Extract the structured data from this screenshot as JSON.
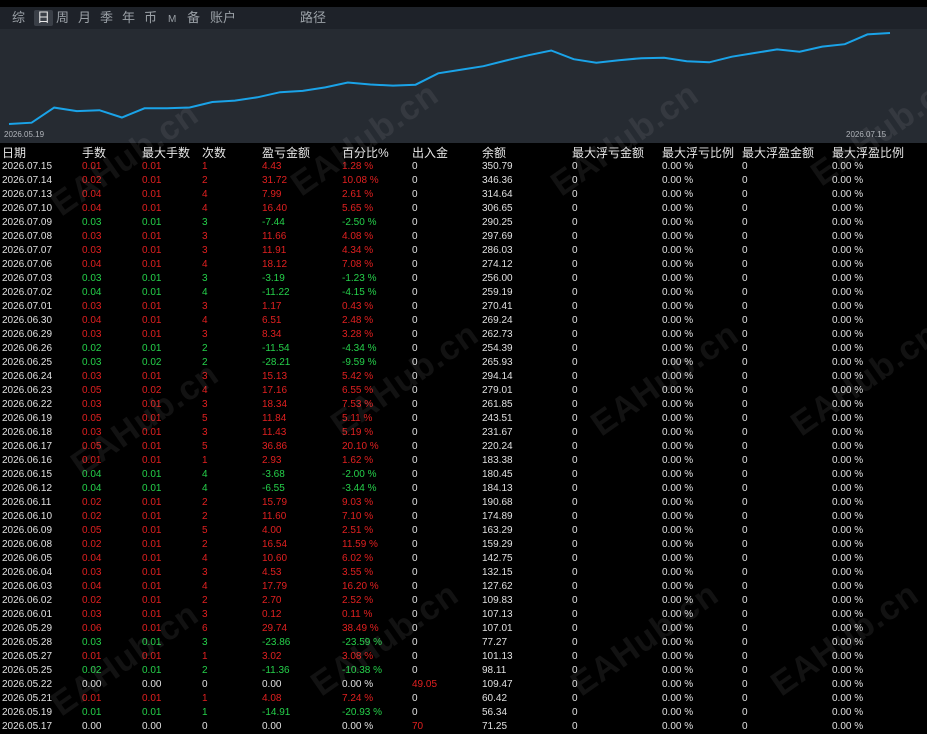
{
  "tabs": [
    "综",
    "日",
    "周",
    "月",
    "季",
    "年",
    "币",
    "M",
    "备",
    "账户",
    "路径"
  ],
  "active_tab": "日",
  "chart": {
    "start_label": "2026.05.19",
    "end_label": "2026.07.15",
    "line_color": "#1aa3e8",
    "equity": [
      56.34,
      60.42,
      109.47,
      98.11,
      101.13,
      77.27,
      107.01,
      107.13,
      109.83,
      127.62,
      132.15,
      142.75,
      159.29,
      163.29,
      174.89,
      190.68,
      184.13,
      180.45,
      183.38,
      220.24,
      231.67,
      243.51,
      261.85,
      279.01,
      294.14,
      265.93,
      254.39,
      262.73,
      269.24,
      270.41,
      259.19,
      256.0,
      274.12,
      286.03,
      297.69,
      290.25,
      306.65,
      314.64,
      346.36,
      350.79
    ]
  },
  "watermark": "EAHub.cn",
  "columns": [
    "日期",
    "手数",
    "最大手数",
    "次数",
    "盈亏金额",
    "百分比%",
    "出入金",
    "余额",
    "最大浮亏金额",
    "最大浮亏比例",
    "最大浮盈金额",
    "最大浮盈比例"
  ],
  "rows": [
    [
      "2026.07.15",
      "0.01",
      "0.01",
      "1",
      "4.43",
      "1.28 %",
      "0",
      "350.79",
      "0",
      "0.00 %",
      "0",
      "0.00 %"
    ],
    [
      "2026.07.14",
      "0.02",
      "0.01",
      "2",
      "31.72",
      "10.08 %",
      "0",
      "346.36",
      "0",
      "0.00 %",
      "0",
      "0.00 %"
    ],
    [
      "2026.07.13",
      "0.04",
      "0.01",
      "4",
      "7.99",
      "2.61 %",
      "0",
      "314.64",
      "0",
      "0.00 %",
      "0",
      "0.00 %"
    ],
    [
      "2026.07.10",
      "0.04",
      "0.01",
      "4",
      "16.40",
      "5.65 %",
      "0",
      "306.65",
      "0",
      "0.00 %",
      "0",
      "0.00 %"
    ],
    [
      "2026.07.09",
      "0.03",
      "0.01",
      "3",
      "-7.44",
      "-2.50 %",
      "0",
      "290.25",
      "0",
      "0.00 %",
      "0",
      "0.00 %"
    ],
    [
      "2026.07.08",
      "0.03",
      "0.01",
      "3",
      "11.66",
      "4.08 %",
      "0",
      "297.69",
      "0",
      "0.00 %",
      "0",
      "0.00 %"
    ],
    [
      "2026.07.07",
      "0.03",
      "0.01",
      "3",
      "11.91",
      "4.34 %",
      "0",
      "286.03",
      "0",
      "0.00 %",
      "0",
      "0.00 %"
    ],
    [
      "2026.07.06",
      "0.04",
      "0.01",
      "4",
      "18.12",
      "7.08 %",
      "0",
      "274.12",
      "0",
      "0.00 %",
      "0",
      "0.00 %"
    ],
    [
      "2026.07.03",
      "0.03",
      "0.01",
      "3",
      "-3.19",
      "-1.23 %",
      "0",
      "256.00",
      "0",
      "0.00 %",
      "0",
      "0.00 %"
    ],
    [
      "2026.07.02",
      "0.04",
      "0.01",
      "4",
      "-11.22",
      "-4.15 %",
      "0",
      "259.19",
      "0",
      "0.00 %",
      "0",
      "0.00 %"
    ],
    [
      "2026.07.01",
      "0.03",
      "0.01",
      "3",
      "1.17",
      "0.43 %",
      "0",
      "270.41",
      "0",
      "0.00 %",
      "0",
      "0.00 %"
    ],
    [
      "2026.06.30",
      "0.04",
      "0.01",
      "4",
      "6.51",
      "2.48 %",
      "0",
      "269.24",
      "0",
      "0.00 %",
      "0",
      "0.00 %"
    ],
    [
      "2026.06.29",
      "0.03",
      "0.01",
      "3",
      "8.34",
      "3.28 %",
      "0",
      "262.73",
      "0",
      "0.00 %",
      "0",
      "0.00 %"
    ],
    [
      "2026.06.26",
      "0.02",
      "0.01",
      "2",
      "-11.54",
      "-4.34 %",
      "0",
      "254.39",
      "0",
      "0.00 %",
      "0",
      "0.00 %"
    ],
    [
      "2026.06.25",
      "0.03",
      "0.02",
      "2",
      "-28.21",
      "-9.59 %",
      "0",
      "265.93",
      "0",
      "0.00 %",
      "0",
      "0.00 %"
    ],
    [
      "2026.06.24",
      "0.03",
      "0.01",
      "3",
      "15.13",
      "5.42 %",
      "0",
      "294.14",
      "0",
      "0.00 %",
      "0",
      "0.00 %"
    ],
    [
      "2026.06.23",
      "0.05",
      "0.02",
      "4",
      "17.16",
      "6.55 %",
      "0",
      "279.01",
      "0",
      "0.00 %",
      "0",
      "0.00 %"
    ],
    [
      "2026.06.22",
      "0.03",
      "0.01",
      "3",
      "18.34",
      "7.53 %",
      "0",
      "261.85",
      "0",
      "0.00 %",
      "0",
      "0.00 %"
    ],
    [
      "2026.06.19",
      "0.05",
      "0.01",
      "5",
      "11.84",
      "5.11 %",
      "0",
      "243.51",
      "0",
      "0.00 %",
      "0",
      "0.00 %"
    ],
    [
      "2026.06.18",
      "0.03",
      "0.01",
      "3",
      "11.43",
      "5.19 %",
      "0",
      "231.67",
      "0",
      "0.00 %",
      "0",
      "0.00 %"
    ],
    [
      "2026.06.17",
      "0.05",
      "0.01",
      "5",
      "36.86",
      "20.10 %",
      "0",
      "220.24",
      "0",
      "0.00 %",
      "0",
      "0.00 %"
    ],
    [
      "2026.06.16",
      "0.01",
      "0.01",
      "1",
      "2.93",
      "1.62 %",
      "0",
      "183.38",
      "0",
      "0.00 %",
      "0",
      "0.00 %"
    ],
    [
      "2026.06.15",
      "0.04",
      "0.01",
      "4",
      "-3.68",
      "-2.00 %",
      "0",
      "180.45",
      "0",
      "0.00 %",
      "0",
      "0.00 %"
    ],
    [
      "2026.06.12",
      "0.04",
      "0.01",
      "4",
      "-6.55",
      "-3.44 %",
      "0",
      "184.13",
      "0",
      "0.00 %",
      "0",
      "0.00 %"
    ],
    [
      "2026.06.11",
      "0.02",
      "0.01",
      "2",
      "15.79",
      "9.03 %",
      "0",
      "190.68",
      "0",
      "0.00 %",
      "0",
      "0.00 %"
    ],
    [
      "2026.06.10",
      "0.02",
      "0.01",
      "2",
      "11.60",
      "7.10 %",
      "0",
      "174.89",
      "0",
      "0.00 %",
      "0",
      "0.00 %"
    ],
    [
      "2026.06.09",
      "0.05",
      "0.01",
      "5",
      "4.00",
      "2.51 %",
      "0",
      "163.29",
      "0",
      "0.00 %",
      "0",
      "0.00 %"
    ],
    [
      "2026.06.08",
      "0.02",
      "0.01",
      "2",
      "16.54",
      "11.59 %",
      "0",
      "159.29",
      "0",
      "0.00 %",
      "0",
      "0.00 %"
    ],
    [
      "2026.06.05",
      "0.04",
      "0.01",
      "4",
      "10.60",
      "6.02 %",
      "0",
      "142.75",
      "0",
      "0.00 %",
      "0",
      "0.00 %"
    ],
    [
      "2026.06.04",
      "0.03",
      "0.01",
      "3",
      "4.53",
      "3.55 %",
      "0",
      "132.15",
      "0",
      "0.00 %",
      "0",
      "0.00 %"
    ],
    [
      "2026.06.03",
      "0.04",
      "0.01",
      "4",
      "17.79",
      "16.20 %",
      "0",
      "127.62",
      "0",
      "0.00 %",
      "0",
      "0.00 %"
    ],
    [
      "2026.06.02",
      "0.02",
      "0.01",
      "2",
      "2.70",
      "2.52 %",
      "0",
      "109.83",
      "0",
      "0.00 %",
      "0",
      "0.00 %"
    ],
    [
      "2026.06.01",
      "0.03",
      "0.01",
      "3",
      "0.12",
      "0.11 %",
      "0",
      "107.13",
      "0",
      "0.00 %",
      "0",
      "0.00 %"
    ],
    [
      "2026.05.29",
      "0.06",
      "0.01",
      "6",
      "29.74",
      "38.49 %",
      "0",
      "107.01",
      "0",
      "0.00 %",
      "0",
      "0.00 %"
    ],
    [
      "2026.05.28",
      "0.03",
      "0.01",
      "3",
      "-23.86",
      "-23.59 %",
      "0",
      "77.27",
      "0",
      "0.00 %",
      "0",
      "0.00 %"
    ],
    [
      "2026.05.27",
      "0.01",
      "0.01",
      "1",
      "3.02",
      "3.08 %",
      "0",
      "101.13",
      "0",
      "0.00 %",
      "0",
      "0.00 %"
    ],
    [
      "2026.05.25",
      "0.02",
      "0.01",
      "2",
      "-11.36",
      "-10.38 %",
      "0",
      "98.11",
      "0",
      "0.00 %",
      "0",
      "0.00 %"
    ],
    [
      "2026.05.22",
      "0.00",
      "0.00",
      "0",
      "0.00",
      "0.00 %",
      "49.05",
      "109.47",
      "0",
      "0.00 %",
      "0",
      "0.00 %"
    ],
    [
      "2026.05.21",
      "0.01",
      "0.01",
      "1",
      "4.08",
      "7.24 %",
      "0",
      "60.42",
      "0",
      "0.00 %",
      "0",
      "0.00 %"
    ],
    [
      "2026.05.19",
      "0.01",
      "0.01",
      "1",
      "-14.91",
      "-20.93 %",
      "0",
      "56.34",
      "0",
      "0.00 %",
      "0",
      "0.00 %"
    ],
    [
      "2026.05.17",
      "0.00",
      "0.00",
      "0",
      "0.00",
      "0.00 %",
      "70",
      "71.25",
      "0",
      "0.00 %",
      "0",
      "0.00 %"
    ]
  ],
  "colors": {
    "profit": "#e02020",
    "loss": "#25d04a",
    "neutral": "#e0e0e0"
  }
}
